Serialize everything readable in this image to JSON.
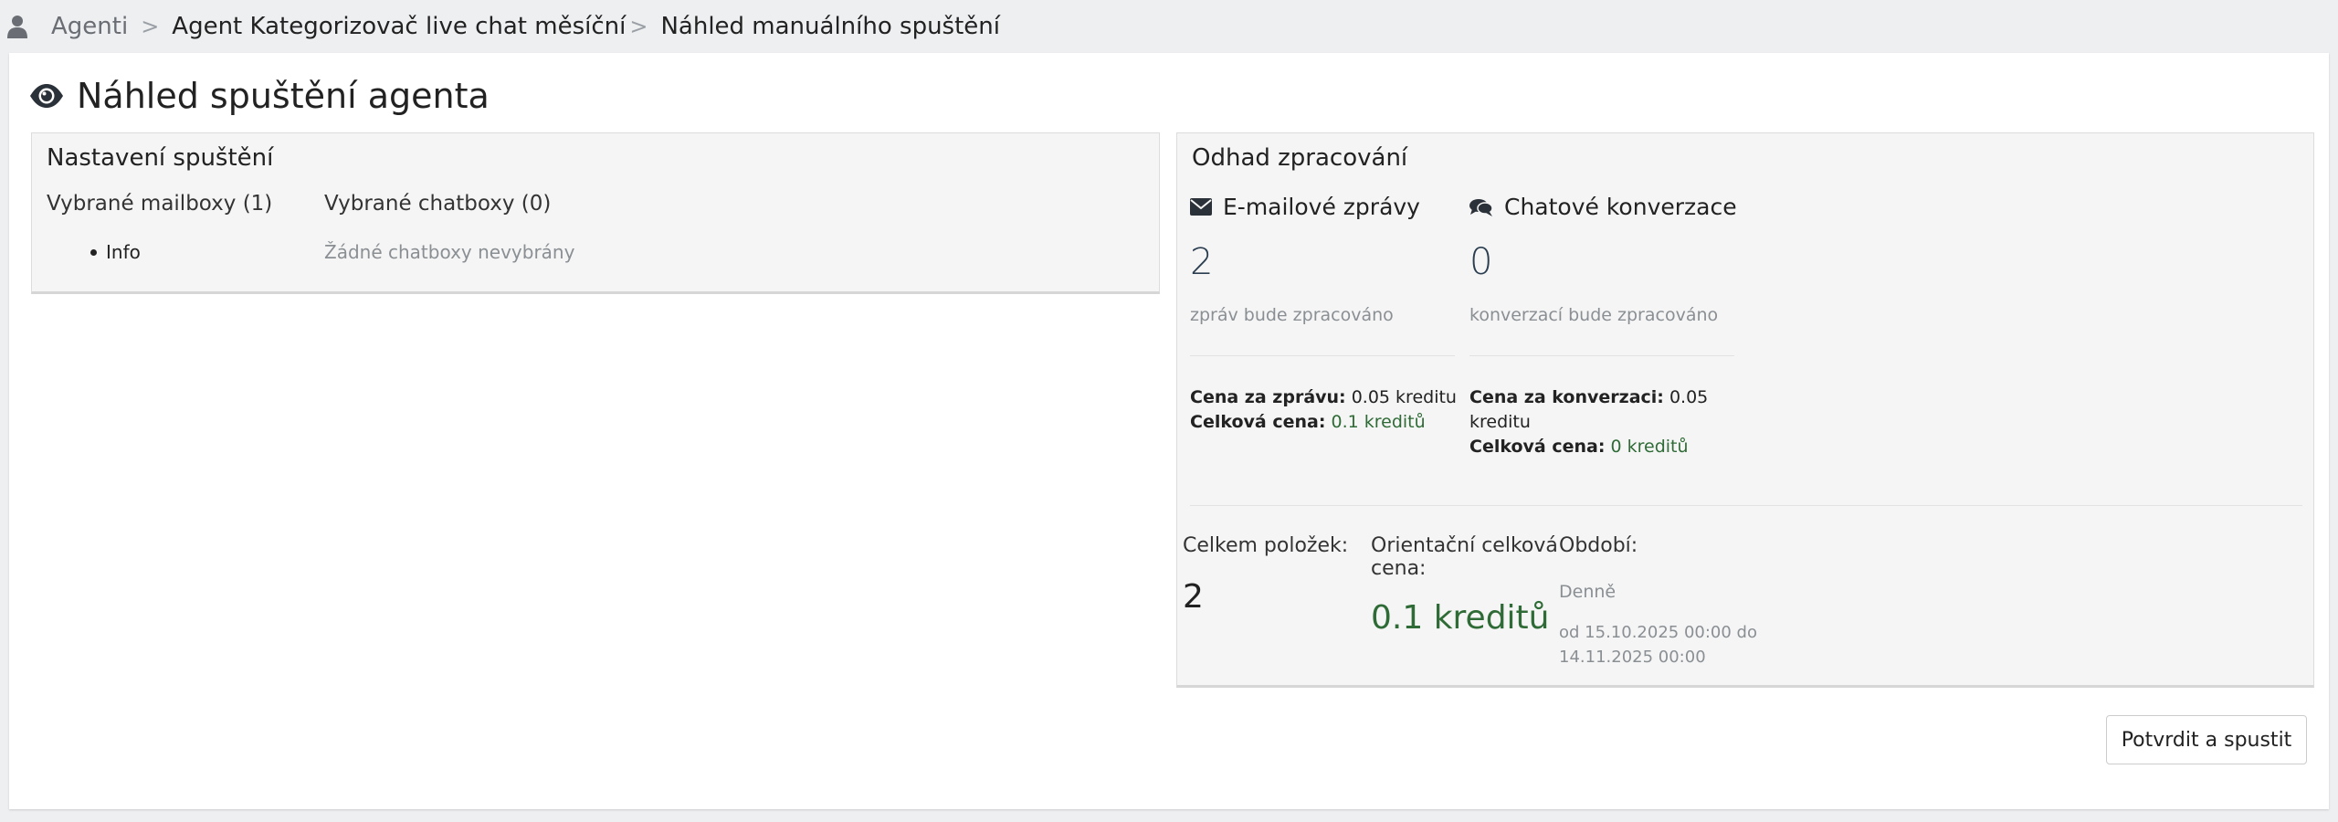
{
  "breadcrumb": {
    "items": [
      "Agenti",
      "Agent Kategorizovač live chat měsíční",
      "Náhled manuálního spuštění"
    ],
    "separator": ">"
  },
  "page": {
    "title": "Náhled spuštění agenta"
  },
  "settings": {
    "title": "Nastavení spuštění",
    "mailboxes_label": "Vybrané mailboxy (1)",
    "mailboxes": [
      "Info"
    ],
    "chatboxes_label": "Vybrané chatboxy (0)",
    "chatboxes_empty": "Žádné chatboxy nevybrány"
  },
  "estimate": {
    "title": "Odhad zpracování",
    "email": {
      "title": "E-mailové zprávy",
      "count": "2",
      "note": "zpráv bude zpracováno",
      "unit_price_label": "Cena za zprávu:",
      "unit_price": "0.05 kreditu",
      "total_label": "Celková cena:",
      "total": "0.1 kreditů"
    },
    "chat": {
      "title": "Chatové konverzace",
      "count": "0",
      "note": "konverzací bude zpracováno",
      "unit_price_label": "Cena za konverzaci:",
      "unit_price_line1": "0.05",
      "unit_price_line2": "kreditu",
      "total_label": "Celková cena:",
      "total": "0 kreditů"
    },
    "summary": {
      "items_label": "Celkem položek:",
      "items_value": "2",
      "price_label_line1": "Orientační celková",
      "price_label_line2": "cena:",
      "price_value": "0.1 kreditů",
      "period_label": "Období:",
      "period_value": "Denně",
      "range_line1": "od 15.10.2025 00:00 do",
      "range_line2": "14.11.2025 00:00"
    }
  },
  "actions": {
    "confirm_label": "Potvrdit a spustit"
  },
  "colors": {
    "accent_green": "#2f6b36",
    "number_blue": "#2b3e50",
    "panel_bg": "#f5f5f5"
  }
}
